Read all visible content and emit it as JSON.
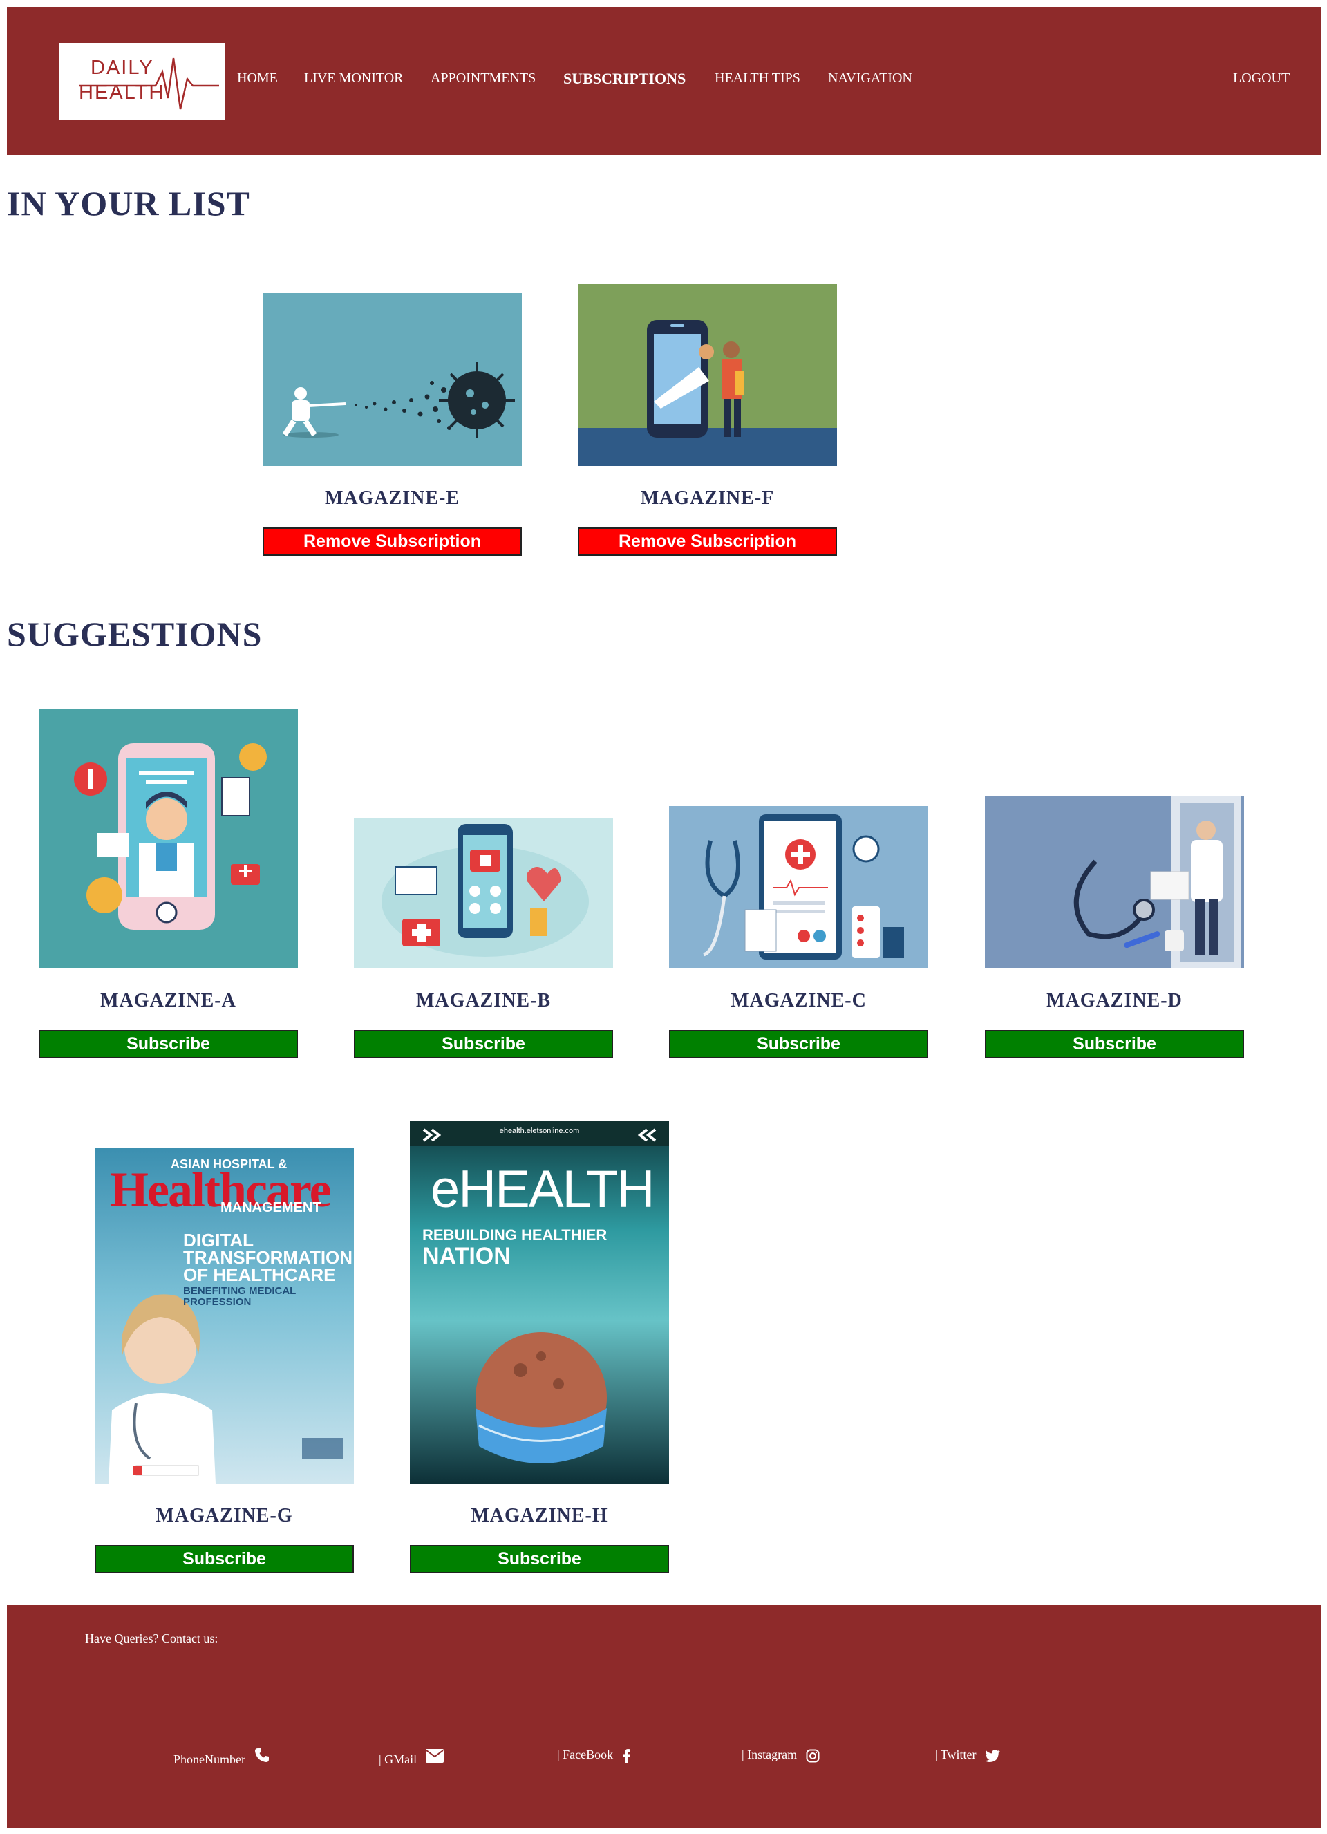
{
  "header": {
    "logo_line1": "DAILY",
    "logo_line2": "HEALTH",
    "nav": [
      "HOME",
      "LIVE MONITOR",
      "APPOINTMENTS",
      "SUBSCRIPTIONS",
      "HEALTH TIPS",
      "NAVIGATION"
    ],
    "active_nav": "SUBSCRIPTIONS",
    "logout": "LOGOUT"
  },
  "list_section": {
    "title": "IN YOUR LIST",
    "items": [
      {
        "name": "MAGAZINE-E",
        "button": "Remove Subscription"
      },
      {
        "name": "MAGAZINE-F",
        "button": "Remove Subscription"
      }
    ]
  },
  "suggestions_section": {
    "title": "SUGGESTIONS",
    "items": [
      {
        "name": "MAGAZINE-A",
        "button": "Subscribe"
      },
      {
        "name": "MAGAZINE-B",
        "button": "Subscribe"
      },
      {
        "name": "MAGAZINE-C",
        "button": "Subscribe"
      },
      {
        "name": "MAGAZINE-D",
        "button": "Subscribe"
      },
      {
        "name": "MAGAZINE-G",
        "button": "Subscribe"
      },
      {
        "name": "MAGAZINE-H",
        "button": "Subscribe"
      }
    ]
  },
  "covers": {
    "g": {
      "top": "ASIAN HOSPITAL &",
      "brand": "Healthcare",
      "sub": "MANAGEMENT",
      "headline": "DIGITAL TRANSFORMATION OF HEALTHCARE",
      "tag": "BENEFITING MEDICAL PROFESSION"
    },
    "h": {
      "url": "ehealth.eletsonline.com",
      "brand": "eHEALTH",
      "headline1": "REBUILDING HEALTHIER",
      "headline2": "NATION"
    }
  },
  "footer": {
    "contact": "Have Queries? Contact us:",
    "links": [
      "PhoneNumber",
      "| GMail",
      "| FaceBook",
      "| Instagram",
      "| Twitter"
    ]
  },
  "colors": {
    "brand": "#8e2a2a",
    "heading": "#2a2f55",
    "remove": "#ff0000",
    "subscribe": "#008000"
  },
  "icons": [
    "heartbeat-icon",
    "phone-icon",
    "mail-icon",
    "facebook-icon",
    "instagram-icon",
    "twitter-icon"
  ]
}
